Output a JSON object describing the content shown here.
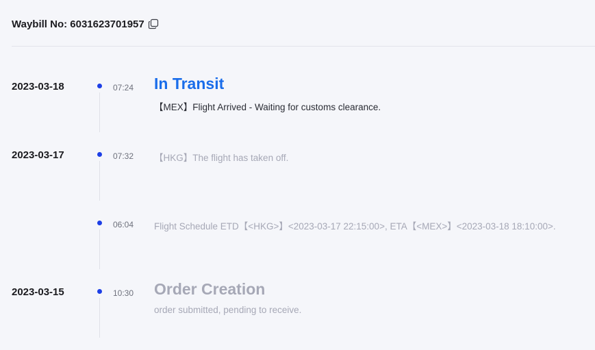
{
  "header": {
    "waybill_label": "Waybill No: 6031623701957",
    "copy_icon": "copy-icon"
  },
  "colors": {
    "accent_blue": "#1a6dea",
    "dot_blue": "#1d3fe6",
    "muted_text": "#a6a8b6",
    "dark_text": "#1b1b1f"
  },
  "events": [
    {
      "date": "2023-03-18",
      "time": "07:24",
      "status": "In Transit",
      "description": "【MEX】Flight Arrived - Waiting for customs clearance."
    },
    {
      "date": "2023-03-17",
      "time": "07:32",
      "status": "",
      "description": "【HKG】The flight has taken off."
    },
    {
      "date": "",
      "time": "06:04",
      "status": "",
      "description": "Flight Schedule ETD【<HKG>】<2023-03-17 22:15:00>, ETA【<MEX>】<2023-03-18 18:10:00>."
    },
    {
      "date": "2023-03-15",
      "time": "10:30",
      "status": "Order Creation",
      "description": "order submitted, pending to receive."
    }
  ]
}
